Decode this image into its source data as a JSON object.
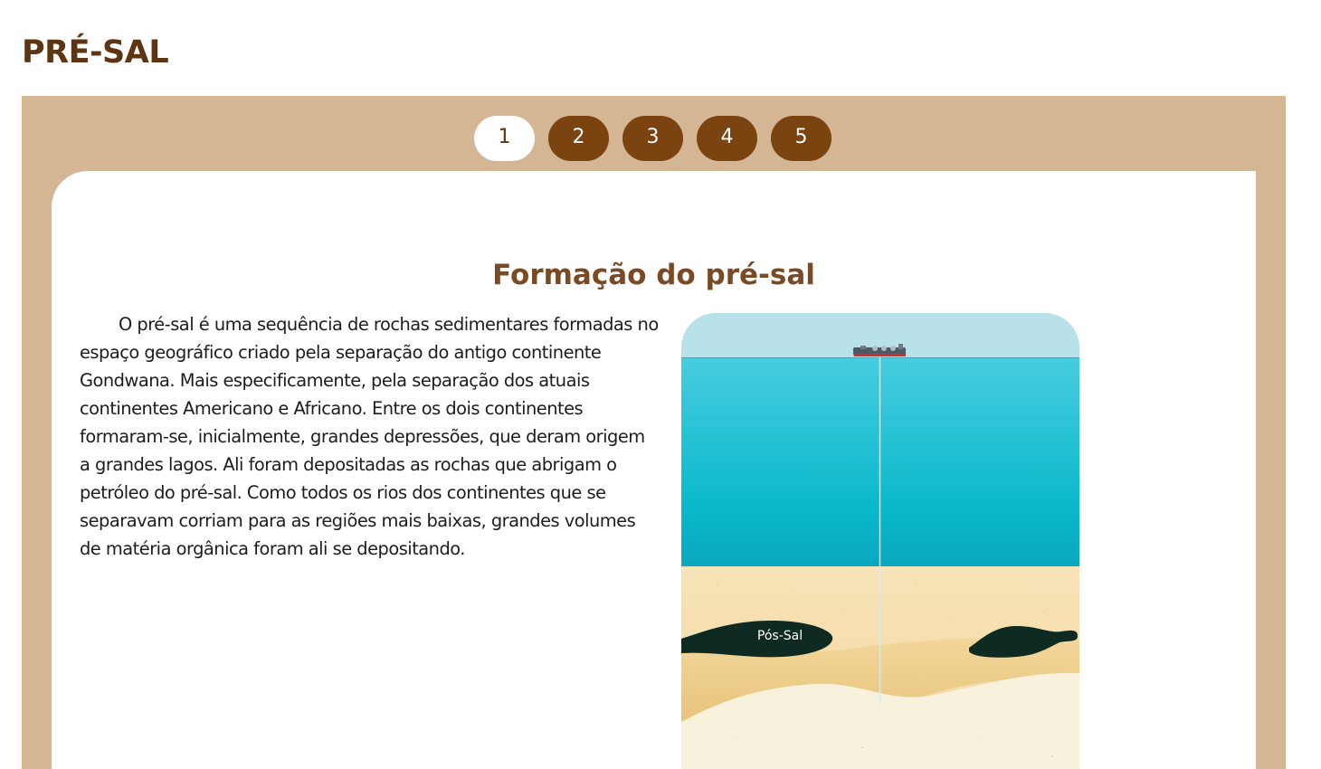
{
  "page": {
    "title": "PRÉ-SAL"
  },
  "pager": {
    "active": 1,
    "pages": [
      "1",
      "2",
      "3",
      "4",
      "5"
    ]
  },
  "content": {
    "heading": "Formação do pré-sal",
    "paragraph": "O pré-sal é uma sequência de rochas sedimentares formadas no espaço geográfico criado pela separação do antigo continente Gondwana. Mais especificamente, pela separação dos atuais continentes Americano e Africano. Entre os dois continentes formaram-se, inicialmente, grandes depressões, que deram origem a grandes lagos. Ali foram depositadas as rochas que abrigam o petróleo do pré-sal. Como todos os rios dos continentes que se separavam corriam para as regiões mais baixas, grandes volumes de matéria orgânica foram ali se depositando."
  },
  "illustration": {
    "layer_label": "Pós-Sal",
    "colors": {
      "sky": "#b8e1ea",
      "sea_top": "#3cc6da",
      "sea_bottom": "#0ab6c9",
      "sand": "#f5dfb0",
      "oil": "#0e2a22"
    }
  },
  "theme": {
    "title_brown": "#5e3512",
    "frame_tan": "#d4b594",
    "button_brown": "#7a4310",
    "heading_brown": "#7a4a25"
  }
}
